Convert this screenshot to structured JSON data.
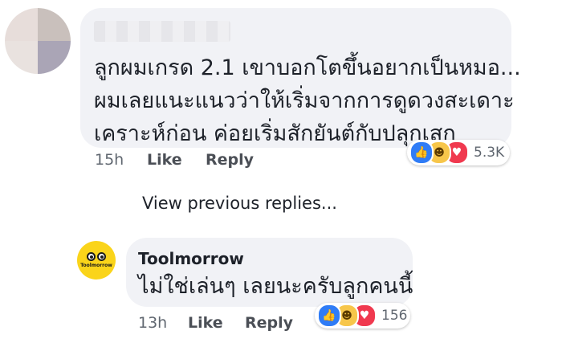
{
  "comment": {
    "text_lines": [
      "ลูกผมเกรด 2.1 เขาบอกโตขึ้นอยากเป็นหมอ...",
      "ผมเลยแนะแนวว่าให้เริ่มจากการดูดวงสะเดาะ",
      "เคราะห์ก่อน ค่อยเริ่มสักยันต์กับปลุกเสก"
    ],
    "time": "15h",
    "like_label": "Like",
    "reply_label": "Reply",
    "reaction_count": "5.3K"
  },
  "view_previous": "View previous replies...",
  "reply": {
    "author": "Toolmorrow",
    "avatar_text": "Toolmorrow",
    "text": "ไม่ใช่เล่นๆ เลยนะครับลูกคนนี้",
    "time": "13h",
    "like_label": "Like",
    "reply_label": "Reply",
    "reaction_count": "156"
  },
  "reaction_icons": [
    "like-icon",
    "haha-icon",
    "love-icon"
  ],
  "colors": {
    "bubble": "#f1f2f6",
    "like": "#2f7cf6",
    "haha": "#f7c64a",
    "love": "#f0394f",
    "avatar_yellow": "#fad41a"
  }
}
